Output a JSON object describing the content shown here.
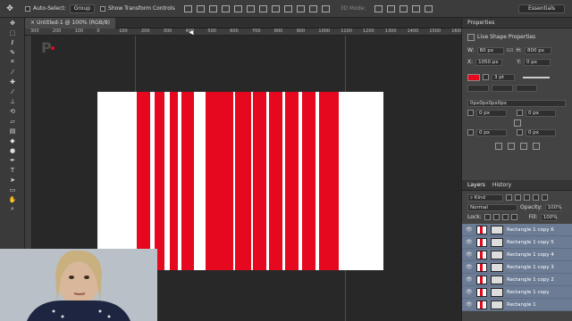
{
  "options_bar": {
    "auto_select_label": "Auto-Select:",
    "auto_select_value": "Group",
    "transform_controls_label": "Show Transform Controls",
    "mode_3d_label": "3D Mode:",
    "workspace": "Essentials"
  },
  "document_tab": {
    "title": "Untitled-1 @ 100% (RGB/8)"
  },
  "ruler": {
    "ticks": [
      "300",
      "200",
      "100",
      "0",
      "100",
      "200",
      "300",
      "400",
      "500",
      "600",
      "700",
      "800",
      "900",
      "1000",
      "1100",
      "1200",
      "1300",
      "1400",
      "1500",
      "1600",
      "1700"
    ]
  },
  "tools": [
    "move-icon",
    "marquee-icon",
    "lasso-icon",
    "quick-select-icon",
    "crop-icon",
    "eyedropper-icon",
    "healing-icon",
    "brush-icon",
    "stamp-icon",
    "history-brush-icon",
    "eraser-icon",
    "gradient-icon",
    "blur-icon",
    "dodge-icon",
    "pen-icon",
    "type-icon",
    "path-select-icon",
    "shape-icon",
    "hand-icon",
    "zoom-icon"
  ],
  "canvas": {
    "background": "#ffffff",
    "bar_color": "#e5081e",
    "bars": [
      {
        "left": 0.136,
        "width": 0.047
      },
      {
        "left": 0.199,
        "width": 0.036
      },
      {
        "left": 0.254,
        "width": 0.028
      },
      {
        "left": 0.293,
        "width": 0.043
      },
      {
        "left": 0.379,
        "width": 0.096
      },
      {
        "left": 0.482,
        "width": 0.055
      },
      {
        "left": 0.545,
        "width": 0.047
      },
      {
        "left": 0.6,
        "width": 0.047
      },
      {
        "left": 0.655,
        "width": 0.047
      },
      {
        "left": 0.715,
        "width": 0.047
      },
      {
        "left": 0.775,
        "width": 0.07
      }
    ]
  },
  "properties_panel": {
    "tab": "Properties",
    "title": "Live Shape Properties",
    "w_label": "W:",
    "w_value": "80 px",
    "go_label": "GO",
    "h_label": "H:",
    "h_value": "800 px",
    "x_label": "X:",
    "x_value": "1050 px",
    "y_label": "Y:",
    "y_value": "0 px",
    "stroke_width": "3 pt",
    "corner_values": "0px0px0px0px",
    "corner_tl": "0 px",
    "corner_tr": "0 px",
    "corner_bl": "0 px",
    "corner_br": "0 px",
    "fill_color": "#e5081e"
  },
  "layers_panel": {
    "tabs": [
      "Layers",
      "History"
    ],
    "filter": "Kind",
    "blend_mode": "Normal",
    "opacity_label": "Opacity:",
    "opacity_value": "100%",
    "lock_label": "Lock:",
    "fill_label": "Fill:",
    "fill_value": "100%",
    "layers": [
      "Rectangle 1 copy 6",
      "Rectangle 1 copy 5",
      "Rectangle 1 copy 4",
      "Rectangle 1 copy 3",
      "Rectangle 1 copy 2",
      "Rectangle 1 copy",
      "Rectangle 1"
    ]
  }
}
